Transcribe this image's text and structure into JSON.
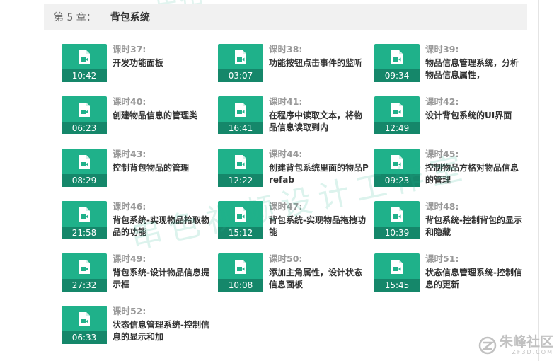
{
  "chapter": {
    "prefix": "第 5 章：",
    "title": "背包系统"
  },
  "lessons": [
    {
      "num": "课时37:",
      "title": "开发功能面板",
      "duration": "10:42"
    },
    {
      "num": "课时38:",
      "title": "功能按钮点击事件的监听",
      "duration": "03:07"
    },
    {
      "num": "课时39:",
      "title": "物品信息管理系统，分析物品信息属性，",
      "duration": "09:34"
    },
    {
      "num": "课时40:",
      "title": "创建物品信息的管理类",
      "duration": "06:23"
    },
    {
      "num": "课时41:",
      "title": "在程序中读取文本，将物品信息读取到内",
      "duration": "16:41"
    },
    {
      "num": "课时42:",
      "title": "设计背包系统的UI界面",
      "duration": "12:49"
    },
    {
      "num": "课时43:",
      "title": "控制背包物品的管理",
      "duration": "08:29"
    },
    {
      "num": "课时44:",
      "title": "创建背包系统里面的物品Prefab",
      "duration": "12:22"
    },
    {
      "num": "课时45:",
      "title": "控制物品方格对物品信息的管理",
      "duration": "09:23"
    },
    {
      "num": "课时46:",
      "title": "背包系统-实现物品拾取物品的功能",
      "duration": "21:58"
    },
    {
      "num": "课时47:",
      "title": "背包系统-实现物品拖拽功能",
      "duration": "15:12"
    },
    {
      "num": "课时48:",
      "title": "背包系统-控制背包的显示和隐藏",
      "duration": "10:39"
    },
    {
      "num": "课时49:",
      "title": "背包系统-设计物品信息提示框",
      "duration": "27:32"
    },
    {
      "num": "课时50:",
      "title": "添加主角属性，设计状态信息面板",
      "duration": "10:08"
    },
    {
      "num": "课时51:",
      "title": "状态信息管理系统-控制信息的更新",
      "duration": "15:45"
    },
    {
      "num": "课时52:",
      "title": "状态信息管理系统-控制信息的显示和加",
      "duration": "06:33"
    }
  ],
  "watermark": {
    "main": "串色视频设计工作室",
    "top": "串色"
  },
  "site_logo": {
    "text": "朱峰社区",
    "sub": "ZF3D.COM"
  },
  "colors": {
    "thumb": "#1fb18a",
    "thumb_bar": "#15876a",
    "header_bg": "#f1f1f1"
  },
  "icons": {
    "lesson": "video-file-icon"
  }
}
